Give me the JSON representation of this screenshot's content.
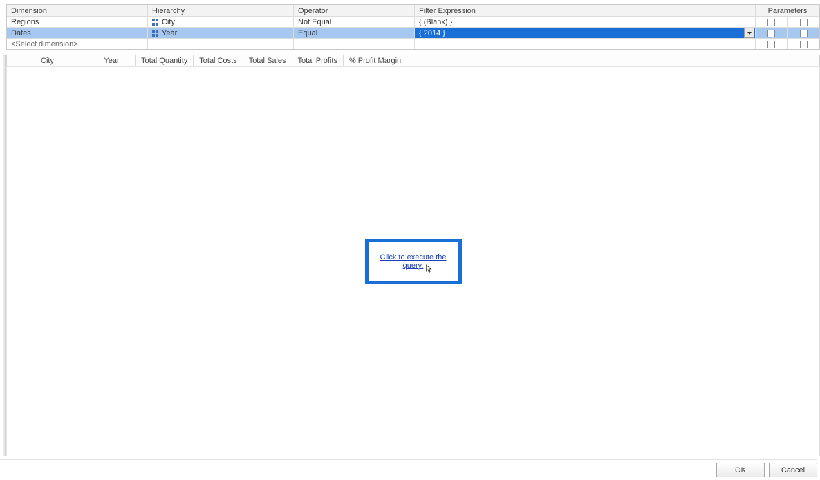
{
  "filter_grid": {
    "headers": {
      "dimension": "Dimension",
      "hierarchy": "Hierarchy",
      "operator": "Operator",
      "filter_expression": "Filter Expression",
      "parameters": "Parameters"
    },
    "rows": [
      {
        "dimension": "Regions",
        "hierarchy": "City",
        "operator": "Not Equal",
        "filter_expression": "{ (Blank) }"
      },
      {
        "dimension": "Dates",
        "hierarchy": "Year",
        "operator": "Equal",
        "filter_expression": "{ 2014 }"
      }
    ],
    "placeholder": "<Select dimension>"
  },
  "columns": [
    "City",
    "Year",
    "Total Quantity",
    "Total Costs",
    "Total Sales",
    "Total Profits",
    "% Profit Margin"
  ],
  "preview": {
    "execute_link": "Click to execute the query."
  },
  "buttons": {
    "ok": "OK",
    "cancel": "Cancel"
  }
}
